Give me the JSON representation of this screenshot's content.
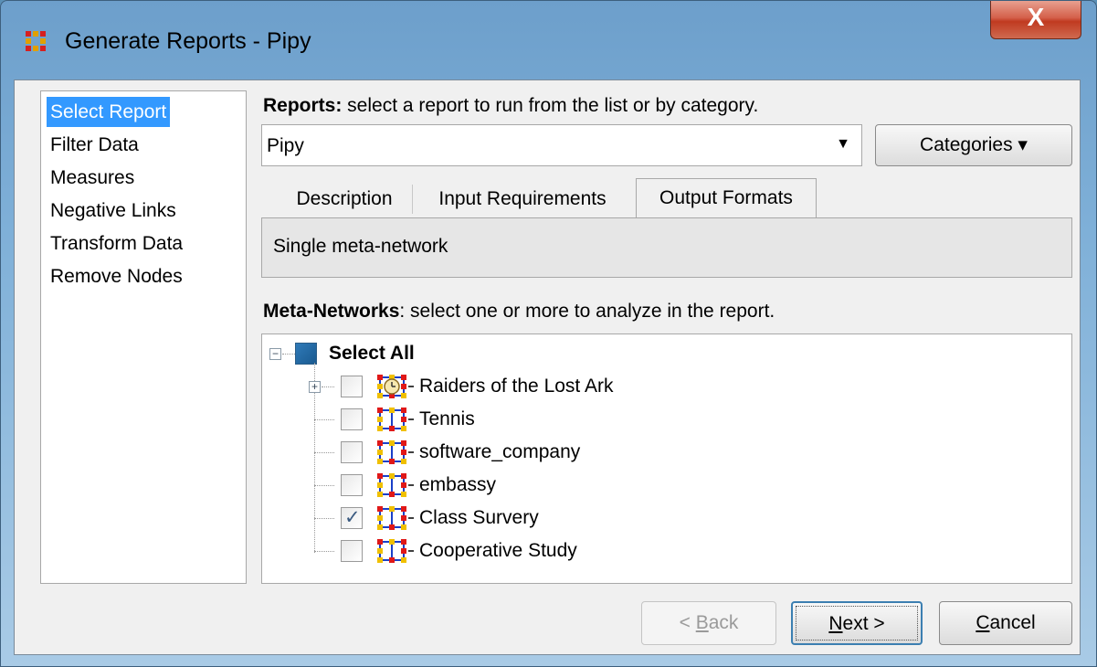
{
  "window": {
    "title": "Generate Reports - Pipy",
    "close_glyph": "X",
    "icon": "network-grid-icon"
  },
  "nav": {
    "items": [
      {
        "label": "Select Report",
        "selected": true
      },
      {
        "label": "Filter Data",
        "selected": false
      },
      {
        "label": "Measures",
        "selected": false
      },
      {
        "label": "Negative Links",
        "selected": false
      },
      {
        "label": "Transform Data",
        "selected": false
      },
      {
        "label": "Remove Nodes",
        "selected": false
      }
    ]
  },
  "reports": {
    "heading_bold": "Reports:",
    "heading_rest": " select a report to run from the list or by category.",
    "selected_value": "Pipy",
    "categories_label": "Categories ▾"
  },
  "tabs": {
    "items": [
      {
        "label": "Description",
        "active": false
      },
      {
        "label": "Input Requirements",
        "active": false
      },
      {
        "label": "Output Formats",
        "active": true
      }
    ],
    "panel_text": "Single meta-network"
  },
  "meta_networks": {
    "heading_bold": "Meta-Networks",
    "heading_rest": ": select one or more to analyze in the report.",
    "select_all_label": "Select All",
    "items": [
      {
        "label": "Raiders of the Lost Ark",
        "checked": false,
        "expandable": true,
        "dynamic": true
      },
      {
        "label": "Tennis",
        "checked": false,
        "expandable": false,
        "dynamic": false
      },
      {
        "label": "software_company",
        "checked": false,
        "expandable": false,
        "dynamic": false
      },
      {
        "label": "embassy",
        "checked": false,
        "expandable": false,
        "dynamic": false
      },
      {
        "label": "Class Survery",
        "checked": true,
        "expandable": false,
        "dynamic": false
      },
      {
        "label": "Cooperative Study",
        "checked": false,
        "expandable": false,
        "dynamic": false
      }
    ]
  },
  "buttons": {
    "back": {
      "prefix": "< ",
      "mnemonic": "B",
      "rest": "ack",
      "enabled": false
    },
    "next": {
      "mnemonic": "N",
      "rest": "ext >",
      "enabled": true
    },
    "cancel": {
      "mnemonic": "C",
      "rest": "ancel",
      "enabled": true
    }
  },
  "colors": {
    "selection": "#3399ff",
    "accent_blue": "#1a5a90",
    "close_red": "#c03a20"
  }
}
